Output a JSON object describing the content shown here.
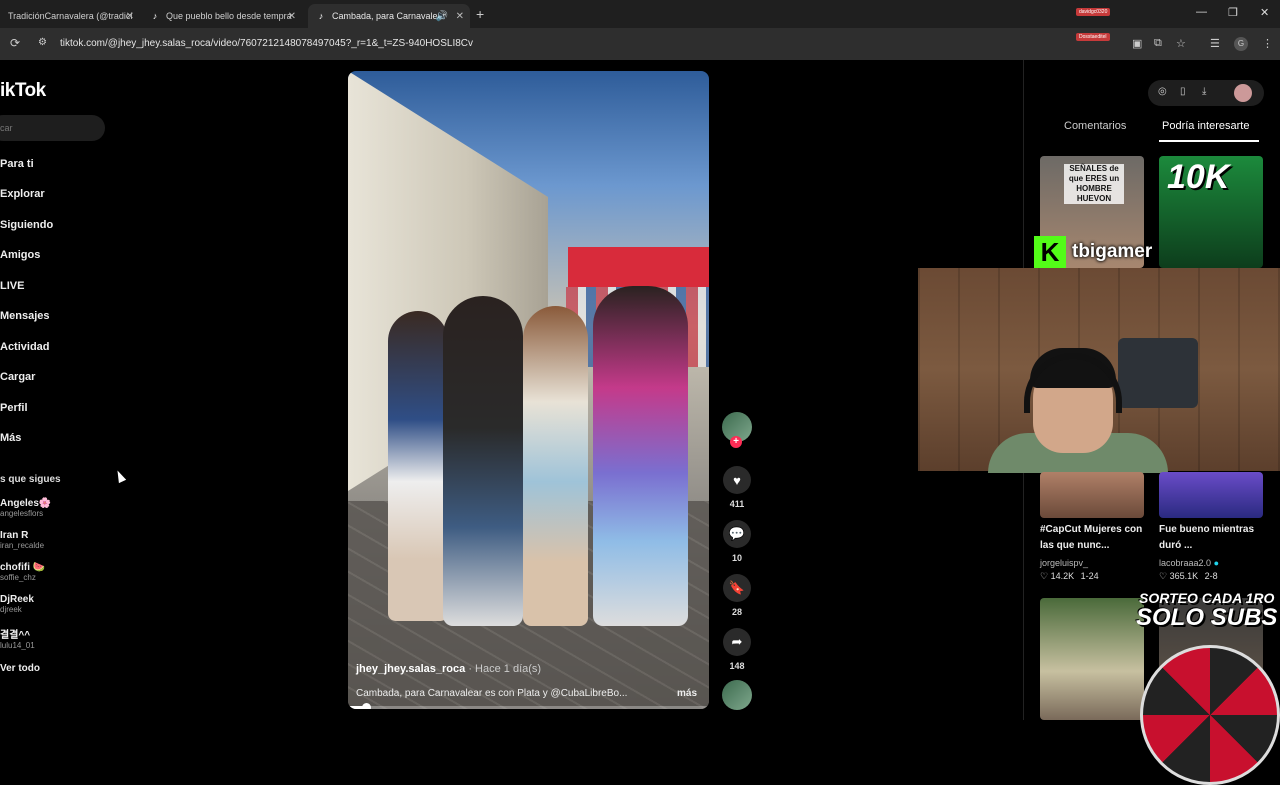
{
  "browser": {
    "tabs": [
      {
        "title": "TradiciónCarnavalera (@tradici"
      },
      {
        "title": "Que pueblo bello desde tempra"
      },
      {
        "title": "Cambada, para Carnavalear"
      }
    ],
    "url": "tiktok.com/@jhey_jhey.salas_roca/video/7607212148078497045?_r=1&_t=ZS-940HOSLI8Cv",
    "overlay_chat": [
      "davidgc0320",
      "Dosstaeditel"
    ]
  },
  "sidebar": {
    "logo": "ikTok",
    "search_placeholder": "car",
    "nav": [
      "Para ti",
      "Explorar",
      "Siguiendo",
      "Amigos",
      "LIVE",
      "Mensajes",
      "Actividad",
      "Cargar",
      "Perfil",
      "Más"
    ],
    "following_title": "s que sigues",
    "following": [
      {
        "name": "Angeles🌸",
        "handle": "angelesflors"
      },
      {
        "name": "Iran R",
        "handle": "iran_recalde"
      },
      {
        "name": "chofifi 🍉",
        "handle": "soffie_chz"
      },
      {
        "name": "DjReek",
        "handle": "djreek"
      },
      {
        "name": "결결^^",
        "handle": "lulu14_01"
      }
    ],
    "see_all": "Ver todo"
  },
  "video": {
    "author": "jhey_jhey.salas_roca",
    "time": "· Hace 1 día(s)",
    "description": "Cambada, para Carnavalear es con Plata y @CubaLibreBo...",
    "more": "más",
    "progress": 0.05
  },
  "actions": {
    "likes": "411",
    "comments": "10",
    "saves": "28",
    "shares": "148"
  },
  "right_panel": {
    "tabs": [
      "Comentarios",
      "Podría interesarte"
    ],
    "thumbs": [
      {
        "overlay": "SEÑALES de que ERES un HOMBRE HUEVON"
      },
      {
        "overlay": "10K"
      },
      {
        "title": "#CapCut Mujeres con las que nunc...",
        "user": "jorgeluispv_",
        "likes": "14.2K",
        "date": "1-24"
      },
      {
        "title": "Fue bueno mientras duró ...",
        "user": "lacobraaa2.0",
        "likes": "365.1K",
        "date": "2-8"
      }
    ]
  },
  "stream_overlay": {
    "channel": "tbigamer",
    "sorteo_line1": "SORTEO CADA 1RO",
    "sorteo_line2": "SOLO SUBS"
  },
  "colors": {
    "tiktok_red": "#fe2c55",
    "kick_green": "#53fc18"
  }
}
